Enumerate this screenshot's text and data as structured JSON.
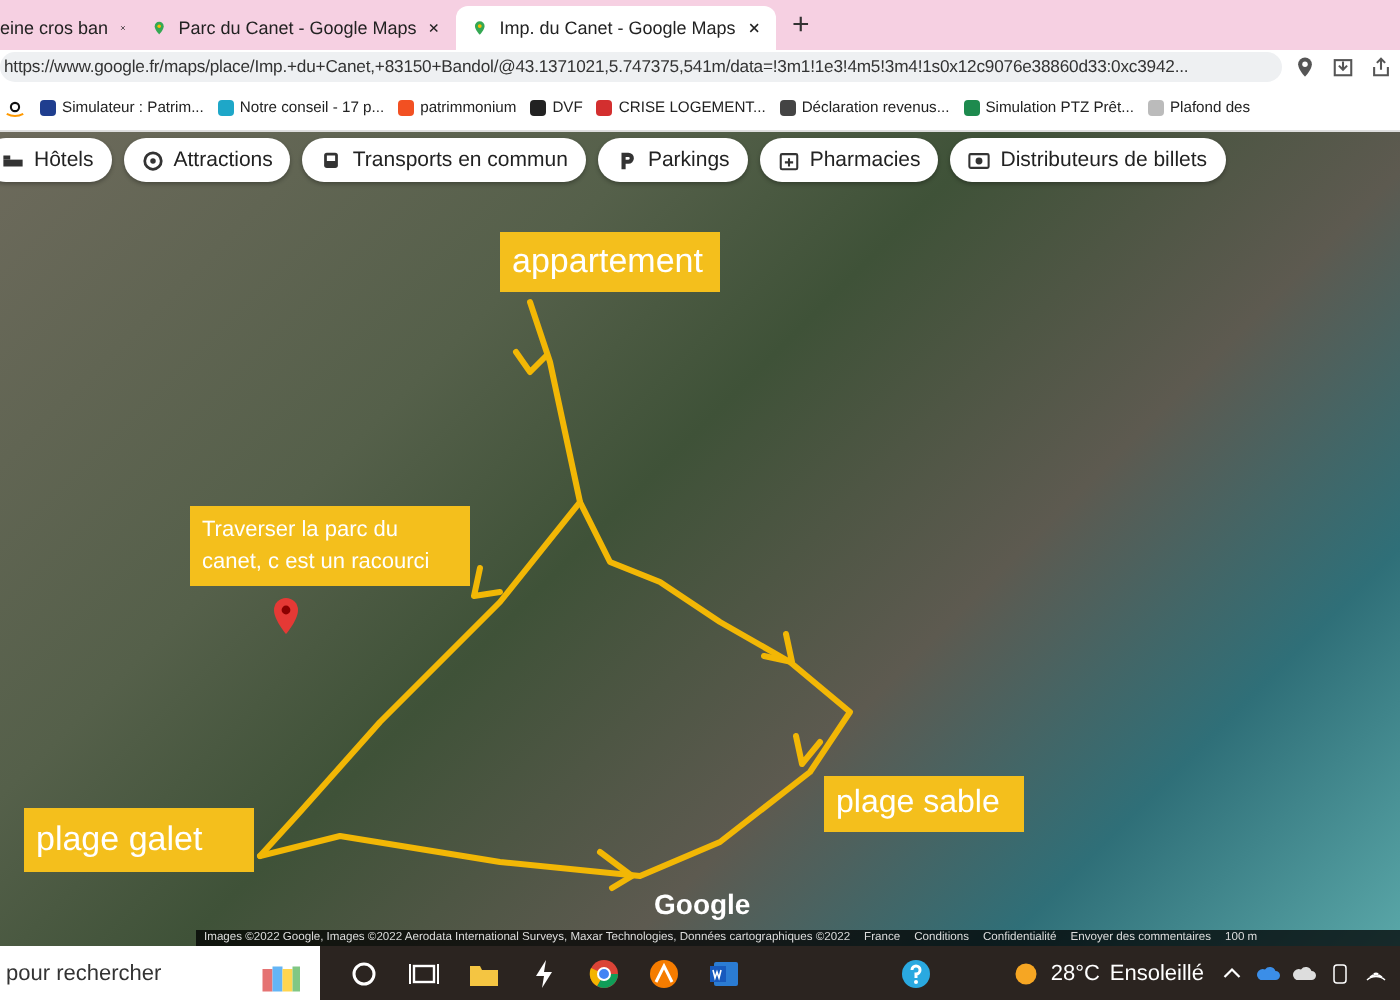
{
  "browser": {
    "tabs": [
      {
        "title": "eine cros ban",
        "selected": false
      },
      {
        "title": "Parc du Canet - Google Maps",
        "selected": false
      },
      {
        "title": "Imp. du Canet - Google Maps",
        "selected": true
      }
    ],
    "new_tab": "+",
    "url": "https://www.google.fr/maps/place/Imp.+du+Canet,+83150+Bandol/@43.1371021,5.747375,541m/data=!3m1!1e3!4m5!3m4!1s0x12c9076e38860d33:0xc3942...",
    "bookmarks": [
      {
        "label": "Simulateur : Patrim...",
        "color": "#1f3e8f"
      },
      {
        "label": "Notre conseil - 17 p...",
        "color": "#1ea7c8"
      },
      {
        "label": "patrimmonium",
        "color": "#f25022"
      },
      {
        "label": "DVF",
        "color": "#222222"
      },
      {
        "label": "CRISE LOGEMENT...",
        "color": "#d32f2f"
      },
      {
        "label": "Déclaration revenus...",
        "color": "#444444"
      },
      {
        "label": "Simulation PTZ Prêt...",
        "color": "#1d8a4e"
      },
      {
        "label": "Plafond des",
        "color": "#bbbbbb"
      }
    ]
  },
  "map": {
    "filters": [
      {
        "label": "Hôtels"
      },
      {
        "label": "Attractions"
      },
      {
        "label": "Transports en commun"
      },
      {
        "label": "Parkings"
      },
      {
        "label": "Pharmacies"
      },
      {
        "label": "Distributeurs de billets"
      }
    ],
    "annotations": [
      {
        "text": "appartement"
      },
      {
        "text": "Traverser la parc du canet, c est un racourci"
      },
      {
        "text": "plage galet"
      },
      {
        "text": "plage sable"
      }
    ],
    "logo": "Google",
    "attribution": [
      "Images ©2022 Google, Images ©2022 Aerodata International Surveys, Maxar Technologies, Données cartographiques ©2022",
      "France",
      "Conditions",
      "Confidentialité",
      "Envoyer des commentaires",
      "100 m"
    ]
  },
  "taskbar": {
    "search_placeholder": "pour rechercher",
    "temperature": "28°C",
    "weather": "Ensoleillé"
  }
}
